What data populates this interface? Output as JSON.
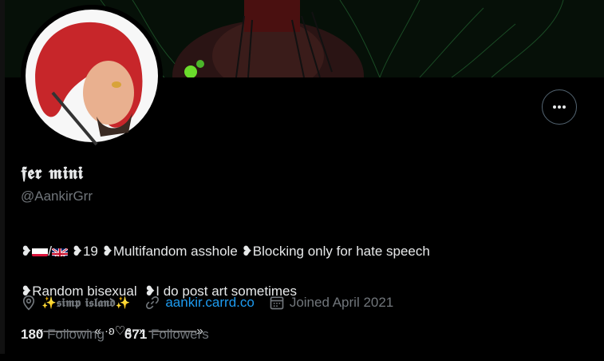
{
  "profile": {
    "display_name": "𝖋𝖊𝖗 𝖒𝖎𝖓𝖎",
    "handle": "@AankirGrr",
    "bio_line1": {
      "prefix": "❥",
      "slash": "/",
      "part_19": "❥19 ",
      "part_multifandom": "❥Multifandom asshole ",
      "part_blocking": "❥Blocking only for hate speech"
    },
    "bio_line2": "❥Random bisexual  ❥I do post art sometimes",
    "bio_line3": "«———— « ·ʚ♡ɞ· » ————»",
    "location": "✨𝖘𝖎𝖒𝖕 𝖎𝖘𝖑𝖆𝖓𝖉✨",
    "website": "aankir.carrd.co",
    "joined": "Joined April 2021",
    "following_count": "180",
    "following_label": "Following",
    "followers_count": "671",
    "followers_label": "Followers"
  },
  "colors": {
    "background": "#000000",
    "text_primary": "#e7e9ea",
    "text_secondary": "#71767b",
    "link": "#1d9bf0",
    "border": "#536471"
  },
  "icons": {
    "more": "more-horizontal-icon",
    "location": "location-pin-icon",
    "link": "link-icon",
    "calendar": "calendar-icon"
  }
}
